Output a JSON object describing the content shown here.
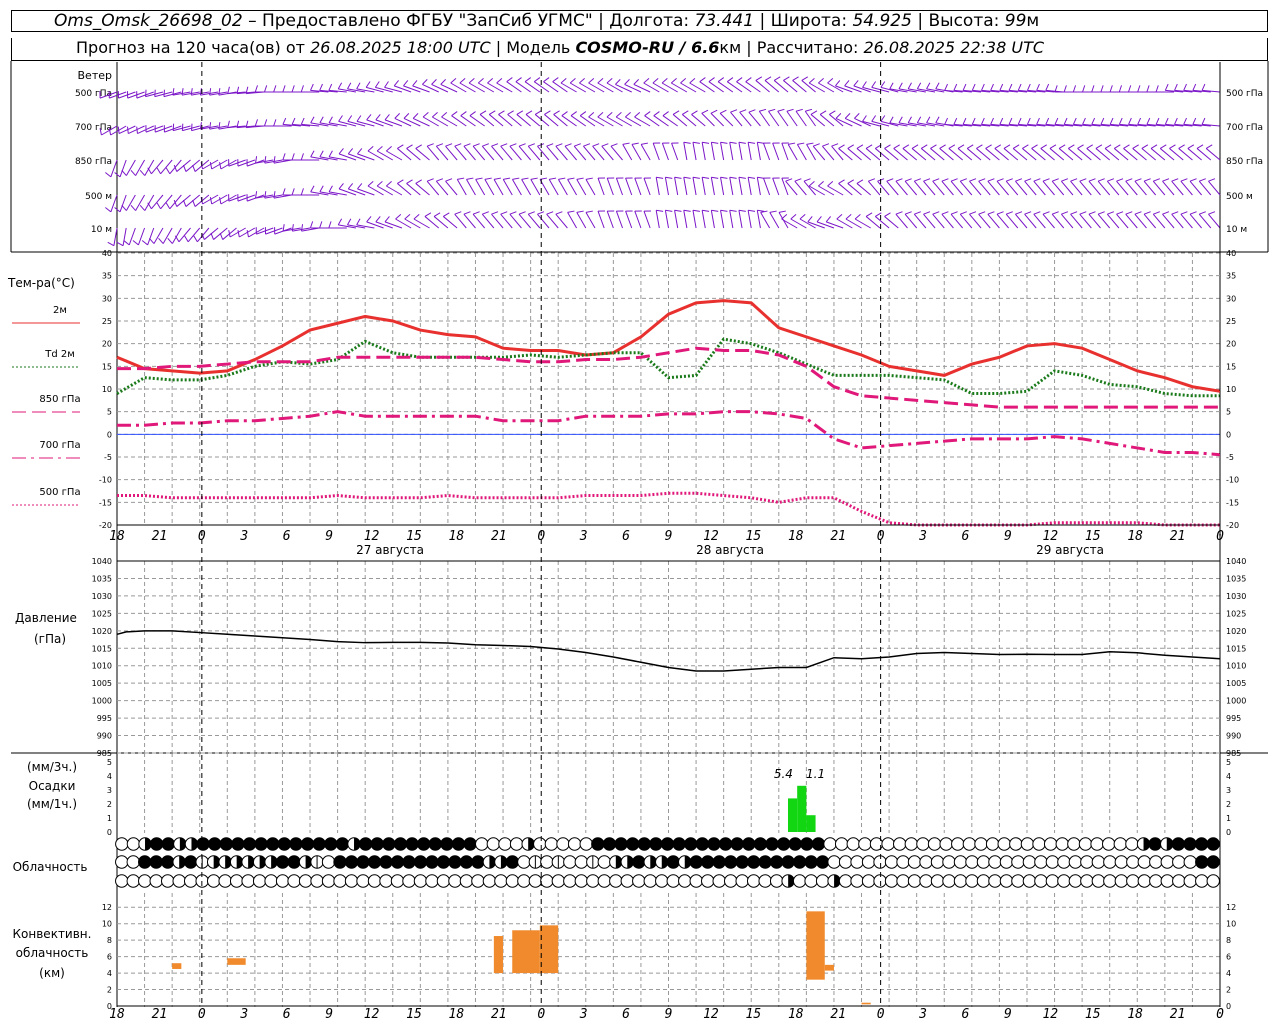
{
  "header": {
    "station": "Oms_Omsk_26698_02",
    "dash": "–",
    "provider": "Предоставлено ФГБУ \"ЗапСиб УГМС\"",
    "sep": "|",
    "lon_label": "Долгота:",
    "lon_value": "73.441",
    "lat_label": "Широта:",
    "lat_value": "54.925",
    "alt_label": "Высота:",
    "alt_value": "99",
    "alt_unit": "м",
    "forecast_label": "Прогноз на 120 часа(ов) от",
    "forecast_start": "26.08.2025 18:00 UTC",
    "model_label": "Модель",
    "model_name": "COSMO-RU / 6.6",
    "model_unit": "км",
    "computed_label": "Рассчитано:",
    "computed_time": "26.08.2025 22:38 UTC"
  },
  "wind_panel": {
    "title": "Ветер",
    "levels": [
      "500 гПа",
      "700 гПа",
      "850 гПа",
      "500 м",
      "10 м"
    ],
    "color": "#7b16c8"
  },
  "time_axis": {
    "hours": [
      "18",
      "21",
      "0",
      "3",
      "6",
      "9",
      "12",
      "15",
      "18",
      "21",
      "0",
      "3",
      "6",
      "9",
      "12",
      "15",
      "18",
      "21",
      "0",
      "3",
      "6",
      "9",
      "12",
      "15",
      "18",
      "21",
      "0"
    ],
    "dates": [
      "27 августа",
      "28 августа",
      "29 августа"
    ]
  },
  "chart_data": [
    {
      "type": "line",
      "title": "Тем-ра(°C)",
      "x_unit": "hours from 26.08.2025 18:00 UTC",
      "ylim": [
        -20,
        40
      ],
      "y_ticks": [
        "40",
        "35",
        "30",
        "25",
        "20",
        "15",
        "10",
        "5",
        "0",
        "-5",
        "-10",
        "-15",
        "-20"
      ],
      "grid": true,
      "series": [
        {
          "name": "2м",
          "color": "#e8312f",
          "style": "solid",
          "x": [
            0,
            3,
            6,
            9,
            12,
            15,
            18,
            21,
            24,
            27,
            30,
            33,
            36,
            39,
            42,
            45,
            48,
            51,
            54,
            57,
            60,
            63,
            66,
            69,
            72,
            75,
            78,
            81,
            84,
            87,
            90,
            93,
            96,
            99,
            102,
            105,
            108,
            111,
            114,
            117,
            120
          ],
          "y": [
            17,
            14.5,
            14,
            13.5,
            14,
            16.5,
            19.5,
            23,
            24.5,
            26,
            25,
            23,
            22,
            21.5,
            19,
            18.5,
            18.5,
            17.5,
            18,
            21.5,
            26.5,
            29,
            29.5,
            29,
            23.5,
            21.5,
            19.5,
            17.5,
            15,
            14,
            13,
            15.5,
            17,
            19.5,
            20,
            19,
            16.5,
            14,
            12.5,
            10.5,
            9.5
          ]
        },
        {
          "name": "Td 2м",
          "color": "#1a7a1a",
          "style": "dotted",
          "x": [
            0,
            3,
            6,
            9,
            12,
            15,
            18,
            21,
            24,
            27,
            30,
            33,
            36,
            39,
            42,
            45,
            48,
            51,
            54,
            57,
            60,
            63,
            66,
            69,
            72,
            75,
            78,
            81,
            84,
            87,
            90,
            93,
            96,
            99,
            102,
            105,
            108,
            111,
            114,
            117,
            120
          ],
          "y": [
            9,
            12.5,
            12,
            12,
            13,
            15,
            16,
            15.5,
            16.5,
            20.5,
            18,
            17,
            17,
            17,
            17,
            17.5,
            17,
            17.5,
            18,
            18,
            12.5,
            13,
            21,
            20,
            18,
            15.5,
            13,
            13,
            13,
            12.5,
            12,
            9,
            9,
            9.5,
            14,
            13,
            11,
            10.5,
            9,
            8.5,
            8.5
          ]
        },
        {
          "name": "850 гПа",
          "color": "#e0187a",
          "style": "dashed",
          "x": [
            0,
            3,
            6,
            9,
            12,
            15,
            18,
            21,
            24,
            27,
            30,
            33,
            36,
            39,
            42,
            45,
            48,
            51,
            54,
            57,
            60,
            63,
            66,
            69,
            72,
            75,
            78,
            81,
            84,
            87,
            90,
            93,
            96,
            99,
            102,
            105,
            108,
            111,
            114,
            117,
            120
          ],
          "y": [
            14.5,
            14.5,
            15,
            15,
            15.5,
            16,
            16,
            16,
            17,
            17,
            17,
            17,
            17,
            17,
            16.5,
            16,
            16,
            16.5,
            16.5,
            17,
            18,
            19,
            18.5,
            18.5,
            17.5,
            15,
            10.5,
            8.5,
            8,
            7.5,
            7,
            6.5,
            6,
            6,
            6,
            6,
            6,
            6,
            6,
            6,
            6
          ]
        },
        {
          "name": "700 гПа",
          "color": "#e0187a",
          "style": "dashdot",
          "x": [
            0,
            3,
            6,
            9,
            12,
            15,
            18,
            21,
            24,
            27,
            30,
            33,
            36,
            39,
            42,
            45,
            48,
            51,
            54,
            57,
            60,
            63,
            66,
            69,
            72,
            75,
            78,
            81,
            84,
            87,
            90,
            93,
            96,
            99,
            102,
            105,
            108,
            111,
            114,
            117,
            120
          ],
          "y": [
            2,
            2,
            2.5,
            2.5,
            3,
            3,
            3.5,
            4,
            5,
            4,
            4,
            4,
            4,
            4,
            3,
            3,
            3,
            4,
            4,
            4,
            4.5,
            4.5,
            5,
            5,
            4.5,
            3.5,
            -1,
            -3,
            -2.5,
            -2,
            -1.5,
            -1,
            -1,
            -1,
            -0.5,
            -1,
            -2,
            -3,
            -4,
            -4,
            -4.5
          ]
        },
        {
          "name": "500 гПа",
          "color": "#e0187a",
          "style": "dotted",
          "x": [
            0,
            3,
            6,
            9,
            12,
            15,
            18,
            21,
            24,
            27,
            30,
            33,
            36,
            39,
            42,
            45,
            48,
            51,
            54,
            57,
            60,
            63,
            66,
            69,
            72,
            75,
            78,
            81,
            84,
            87,
            90,
            93,
            96,
            99,
            102,
            105,
            108,
            111,
            114,
            117,
            120
          ],
          "y": [
            -13.5,
            -13.5,
            -14,
            -14,
            -14,
            -14,
            -14,
            -14,
            -13.5,
            -14,
            -14,
            -14,
            -13.5,
            -14,
            -14,
            -14,
            -14,
            -13.5,
            -13.5,
            -13.5,
            -13,
            -13,
            -13.5,
            -14,
            -15,
            -14,
            -14,
            -17,
            -19.5,
            -20,
            -20,
            -20,
            -20,
            -20,
            -19.5,
            -19.5,
            -19.5,
            -19.5,
            -20,
            -20,
            -20
          ]
        }
      ]
    },
    {
      "type": "line",
      "title": "Давление",
      "ylabel": "(гПа)",
      "ylim": [
        985,
        1040
      ],
      "y_ticks": [
        "1040",
        "1035",
        "1030",
        "1025",
        "1020",
        "1015",
        "1010",
        "1005",
        "1000",
        "995",
        "990",
        "985"
      ],
      "series": [
        {
          "color": "#000000",
          "x": [
            0,
            1,
            3,
            6,
            9,
            12,
            15,
            18,
            21,
            24,
            27,
            30,
            33,
            36,
            39,
            42,
            45,
            48,
            51,
            54,
            57,
            60,
            63,
            66,
            69,
            72,
            75,
            78,
            81,
            84,
            87,
            90,
            93,
            96,
            99,
            102,
            105,
            108,
            111,
            114,
            117,
            120
          ],
          "y": [
            1019,
            1019.7,
            1020,
            1020,
            1019.5,
            1019,
            1018.5,
            1018,
            1017.5,
            1016.9,
            1016.6,
            1016.7,
            1016.7,
            1016.5,
            1016,
            1015.8,
            1015.5,
            1014.8,
            1013.8,
            1012.5,
            1011,
            1009.5,
            1008.5,
            1008.5,
            1009,
            1009.5,
            1009.5,
            1012.3,
            1012,
            1012.5,
            1013.5,
            1013.8,
            1013.5,
            1013.2,
            1013.3,
            1013.2,
            1013.2,
            1014,
            1013.7,
            1013,
            1012.5,
            1012
          ]
        }
      ]
    },
    {
      "type": "bar",
      "title": "Осадки",
      "ylabel": "(мм/3ч.) / (мм/1ч.)",
      "ylim": [
        0,
        5
      ],
      "y_ticks": [
        "5",
        "4",
        "3",
        "2",
        "1",
        "0"
      ],
      "bars": [
        {
          "x": 73,
          "width": 1,
          "value": 2.4
        },
        {
          "x": 74,
          "width": 1,
          "value": 3.3
        },
        {
          "x": 75,
          "width": 1,
          "value": 1.2
        }
      ],
      "labels": [
        {
          "x": 72.5,
          "text": "5.4"
        },
        {
          "x": 76,
          "text": "1.1"
        }
      ],
      "color": "#11d611"
    },
    {
      "type": "bar",
      "title": "Конвективн. облачность",
      "ylabel": "(км)",
      "ylim": [
        0,
        13
      ],
      "y_ticks": [
        "12",
        "10",
        "8",
        "6",
        "4",
        "2",
        "0"
      ],
      "bars": [
        {
          "x": 6,
          "width": 1,
          "bottom": 4.5,
          "top": 5.2
        },
        {
          "x": 12,
          "width": 2,
          "bottom": 5.0,
          "top": 5.8
        },
        {
          "x": 41,
          "width": 1,
          "bottom": 4.0,
          "top": 8.5
        },
        {
          "x": 43,
          "width": 3,
          "bottom": 4.0,
          "top": 9.2
        },
        {
          "x": 46,
          "width": 2,
          "bottom": 4.0,
          "top": 9.8
        },
        {
          "x": 75,
          "width": 2,
          "bottom": 3.2,
          "top": 11.5
        },
        {
          "x": 77,
          "width": 1,
          "bottom": 4.3,
          "top": 5.0
        },
        {
          "x": 81,
          "width": 1,
          "bottom": 0.2,
          "top": 0.4
        }
      ],
      "color": "#f08a2c"
    }
  ],
  "cloud_panel": {
    "title": "Облачность",
    "rows": [
      "OOHFFHHFFFFFFFFFFFFFHFFFFFFFFFFOOOOHOOOOOFFFFFFFFFFFFFFFFFFFFOOOOOOOOOOOOOOOOOOOOOOOOOOOHFHFFFF",
      "OOFFFHFQHHHHHHFFHQOFFFFFFFFFFFFFHHFOQOQOOQOHHFHHFHFFFFFFFFFFFFOOOOOOOOOOOOOOOOOOOOOOOOOOOOOOOOFF",
      "OOOOOOOOOOOOOOOOOOOOOOOOOOOOOOOOOOOOOOOOOOOOOOOOOOOOOOOOOOHOOOHOOOOOOOOOOOOOOOOOOOOOOOOOOOOOOOOO"
    ]
  },
  "temp_legend": [
    "2м",
    "Td  2м",
    "850 гПа",
    "700 гПа",
    "500 гПа"
  ],
  "precip_labels": {
    "line1": "(мм/3ч.)",
    "line2": "Осадки",
    "line3": "(мм/1ч.)"
  },
  "pressure_labels": {
    "line1": "Давление",
    "line2": "(гПа)"
  },
  "convective_labels": {
    "line1": "Конвективн.",
    "line2": "облачность",
    "line3": "(км)"
  },
  "wind_direction_deg_by_level": {
    "500 гПа": [
      250,
      250,
      255,
      260,
      260,
      265,
      270,
      270,
      275,
      280,
      285,
      290,
      295,
      300,
      300,
      305,
      305,
      300,
      300,
      295,
      300,
      300,
      305,
      305,
      310,
      310,
      300,
      290,
      285,
      280,
      280,
      275,
      275,
      275,
      275,
      270,
      270,
      270,
      270,
      275,
      275
    ],
    "700 гПа": [
      240,
      245,
      250,
      255,
      260,
      265,
      270,
      275,
      280,
      285,
      290,
      295,
      300,
      305,
      310,
      310,
      310,
      305,
      300,
      300,
      305,
      310,
      315,
      320,
      325,
      325,
      310,
      295,
      285,
      280,
      280,
      275,
      275,
      275,
      275,
      275,
      275,
      275,
      275,
      275,
      275
    ],
    "850 гПа": [
      200,
      210,
      220,
      230,
      240,
      250,
      260,
      270,
      280,
      290,
      300,
      310,
      320,
      320,
      320,
      320,
      320,
      320,
      320,
      330,
      340,
      350,
      350,
      350,
      340,
      330,
      320,
      310,
      310,
      310,
      310,
      310,
      310,
      310,
      310,
      310,
      310,
      310,
      310,
      310,
      310
    ],
    "500 м": [
      200,
      210,
      220,
      230,
      240,
      250,
      260,
      270,
      280,
      290,
      300,
      310,
      320,
      330,
      330,
      330,
      330,
      330,
      340,
      340,
      350,
      350,
      350,
      350,
      340,
      320,
      300,
      310,
      320,
      320,
      320,
      320,
      320,
      320,
      320,
      320,
      320,
      320,
      320,
      320,
      320
    ],
    "10 м": [
      190,
      200,
      210,
      220,
      230,
      240,
      250,
      260,
      270,
      280,
      290,
      300,
      310,
      320,
      320,
      320,
      320,
      330,
      340,
      340,
      350,
      350,
      350,
      350,
      330,
      300,
      290,
      300,
      310,
      320,
      320,
      320,
      320,
      320,
      320,
      320,
      320,
      320,
      320,
      320,
      320
    ]
  }
}
